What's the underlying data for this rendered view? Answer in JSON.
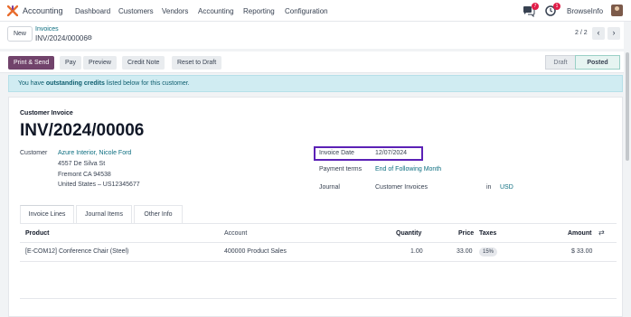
{
  "navbar": {
    "app_name": "Accounting",
    "menu": [
      "Dashboard",
      "Customers",
      "Vendors",
      "Accounting",
      "Reporting",
      "Configuration"
    ],
    "chat_badge": "7",
    "activity_badge": "1",
    "company": "BrowseInfo"
  },
  "control": {
    "new_label": "New",
    "breadcrumb_parent": "Invoices",
    "breadcrumb_current": "INV/2024/00006",
    "pager": "2 / 2"
  },
  "actions": {
    "print_send": "Print & Send",
    "pay": "Pay",
    "preview": "Preview",
    "credit_note": "Credit Note",
    "reset_draft": "Reset to Draft",
    "status_draft": "Draft",
    "status_posted": "Posted"
  },
  "alert": {
    "prefix": "You have ",
    "bold": "outstanding credits",
    "suffix": " listed below for this customer."
  },
  "invoice": {
    "type": "Customer Invoice",
    "name": "INV/2024/00006",
    "customer_label": "Customer",
    "customer_name": "Azure Interior, Nicole Ford",
    "address1": "4557 De Silva St",
    "address2": "Fremont CA 94538",
    "address3": "United States – US12345677",
    "invoice_date_label": "Invoice Date",
    "invoice_date": "12/07/2024",
    "payment_terms_label": "Payment terms",
    "payment_terms": "End of Following Month",
    "journal_label": "Journal",
    "journal": "Customer Invoices",
    "in_label": "in",
    "currency": "USD"
  },
  "tabs": [
    "Invoice Lines",
    "Journal Items",
    "Other Info"
  ],
  "table": {
    "headers": {
      "product": "Product",
      "account": "Account",
      "quantity": "Quantity",
      "price": "Price",
      "taxes": "Taxes",
      "amount": "Amount"
    },
    "rows": [
      {
        "product": "[E-COM12] Conference Chair (Steel)",
        "account": "400000 Product Sales",
        "quantity": "1.00",
        "price": "33.00",
        "taxes": "15%",
        "amount": "$ 33.00"
      }
    ]
  },
  "colors": {
    "brand": "#71436b",
    "link": "#0d6e80",
    "highlight": "#5b21b6"
  }
}
